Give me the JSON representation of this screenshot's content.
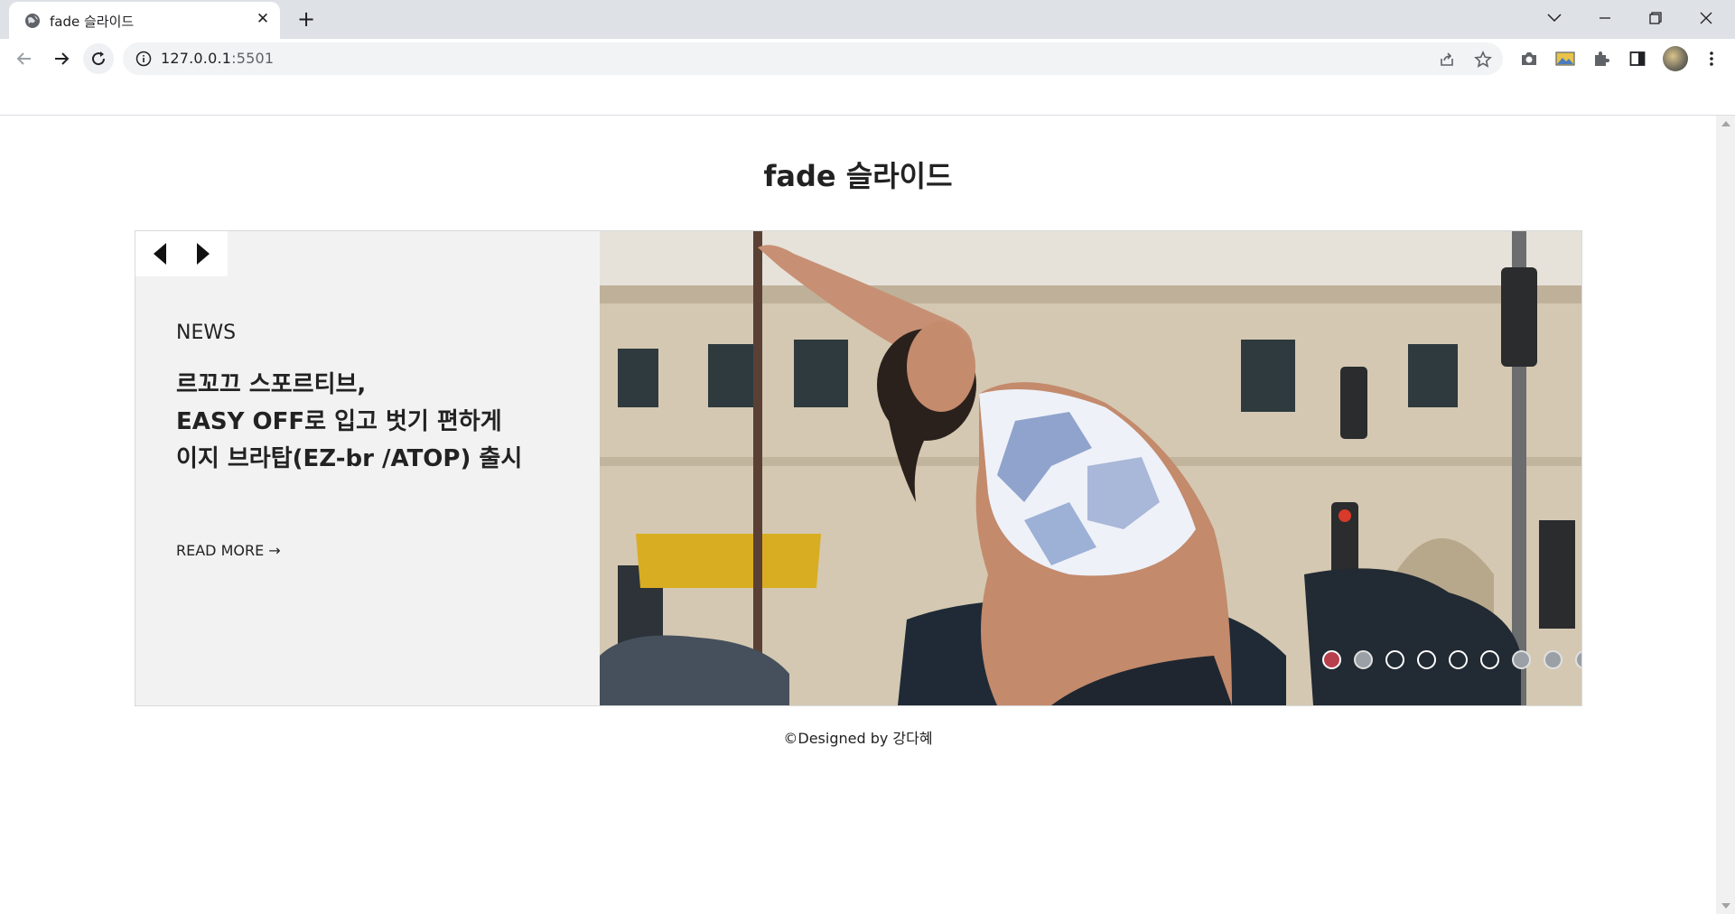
{
  "browser": {
    "tab_title": "fade 슬라이드",
    "url_host": "127.0.0.1",
    "url_port": ":5501",
    "icons": [
      "globe-icon",
      "close-icon",
      "plus-icon",
      "chevron-down-icon",
      "minimize-icon",
      "restore-icon",
      "close-window-icon",
      "back-icon",
      "forward-icon",
      "reload-icon",
      "info-icon",
      "share-icon",
      "star-icon",
      "camera-icon",
      "image-icon",
      "puzzle-icon",
      "sidepanel-icon",
      "avatar",
      "kebab-menu-icon"
    ]
  },
  "page": {
    "title": "fade 슬라이드",
    "slide": {
      "category": "NEWS",
      "headline_lines": [
        "르꼬끄 스포르티브,",
        "EASY OFF로 입고 벗기 편하게",
        "이지 브라탑(EZ-br /ATOP) 출시"
      ],
      "read_more": "READ MORE →"
    },
    "pagination": {
      "count": 9,
      "active_index": 0,
      "states": [
        "active",
        "grey",
        "outline",
        "outline",
        "outline",
        "outline",
        "grey",
        "grey",
        "grey"
      ]
    },
    "footer": "©Designed by 강다혜"
  },
  "colors": {
    "active_dot": "#b8404c",
    "panel_bg": "#f2f2f2",
    "tabstrip_bg": "#dee1e6"
  }
}
